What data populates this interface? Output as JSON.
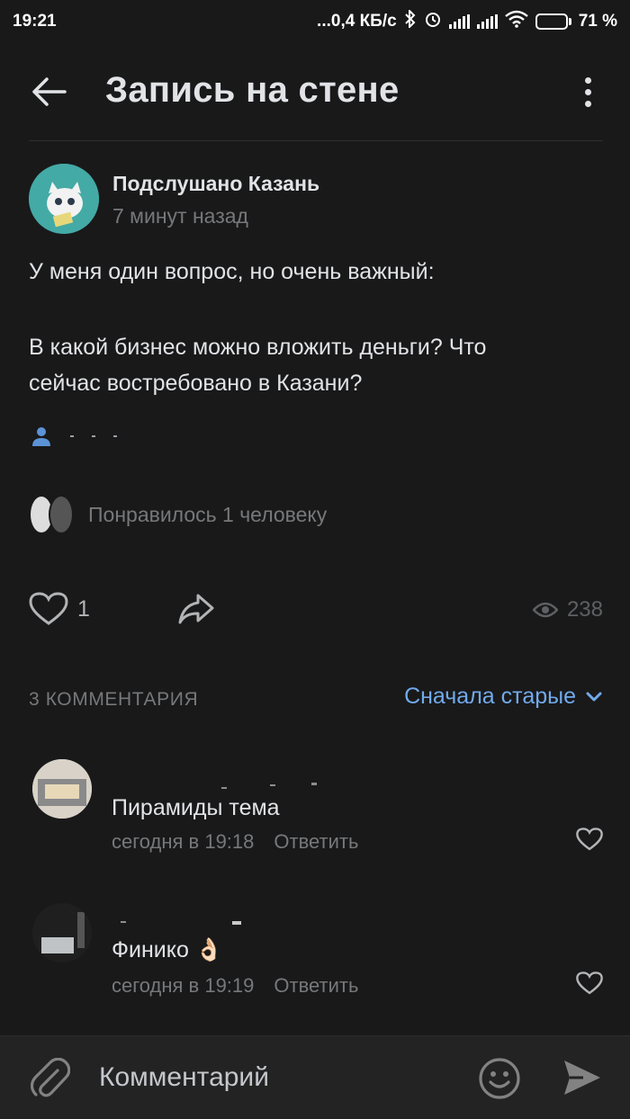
{
  "status_bar": {
    "time": "19:21",
    "network": "...0,4 КБ/с",
    "battery_percent": "71 %",
    "battery_level": 0.71
  },
  "header": {
    "title": "Запись на стене"
  },
  "post": {
    "author": "Подслушано Казань",
    "time": "7 минут назад",
    "text_line1": "У меня один вопрос, но очень важный:",
    "text_line2": "В какой бизнес можно вложить деньги? Что",
    "text_line3": "сейчас востребовано в Казани?",
    "liked_by": "Понравилось 1 человеку",
    "like_count": "1",
    "views": "238"
  },
  "comments": {
    "count_label": "3 КОММЕНТАРИЯ",
    "sort_label": "Сначала старые",
    "items": [
      {
        "text": "Пирамиды тема",
        "time": "сегодня в 19:18",
        "reply": "Ответить"
      },
      {
        "text": "Финико 👌🏻",
        "time": "сегодня в 19:19",
        "reply": "Ответить"
      }
    ]
  },
  "composer": {
    "placeholder": "Комментарий"
  },
  "colors": {
    "background": "#19191a",
    "accent": "#71aaeb",
    "secondary_text": "#76787a"
  }
}
